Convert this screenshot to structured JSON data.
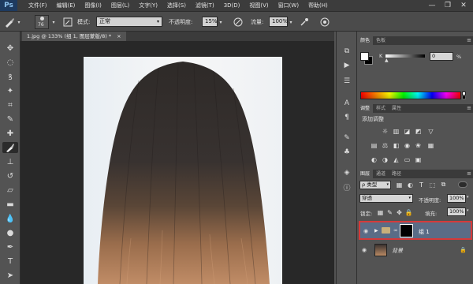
{
  "app": {
    "logo": "Ps"
  },
  "menu": [
    "文件(F)",
    "编辑(E)",
    "图像(I)",
    "图层(L)",
    "文字(Y)",
    "选择(S)",
    "滤镜(T)",
    "3D(D)",
    "视图(V)",
    "窗口(W)",
    "帮助(H)"
  ],
  "window_controls": {
    "minimize": "—",
    "restore": "❐",
    "close": "✕"
  },
  "options": {
    "brush_size": "76",
    "mode_label": "模式:",
    "mode_value": "正常",
    "opacity_label": "不透明度:",
    "opacity_value": "15%",
    "flow_label": "流量:",
    "flow_value": "100%"
  },
  "document": {
    "tab_title": "1.jpg @ 133% (组 1, 图层蒙版/8) *",
    "tab_close": "×"
  },
  "color_panel": {
    "tabs": [
      "颜色",
      "色板"
    ],
    "channel_label": "K",
    "value": "0",
    "unit": "%"
  },
  "adjust_panel": {
    "tabs": [
      "调整",
      "样式",
      "属性"
    ],
    "title": "添加调整"
  },
  "layers_panel": {
    "tabs": [
      "图层",
      "通道",
      "路径"
    ],
    "filter_value": "ρ 类型",
    "blend_mode": "穿透",
    "opacity_label": "不透明度:",
    "opacity_value": "100%",
    "lock_label": "锁定:",
    "fill_label": "填充:",
    "fill_value": "100%",
    "layers": [
      {
        "name": "组 1",
        "selected": true
      },
      {
        "name": "背景",
        "selected": false
      }
    ]
  },
  "colors": {
    "highlight": "#d43a3a",
    "selected_row": "#5a6c86"
  }
}
